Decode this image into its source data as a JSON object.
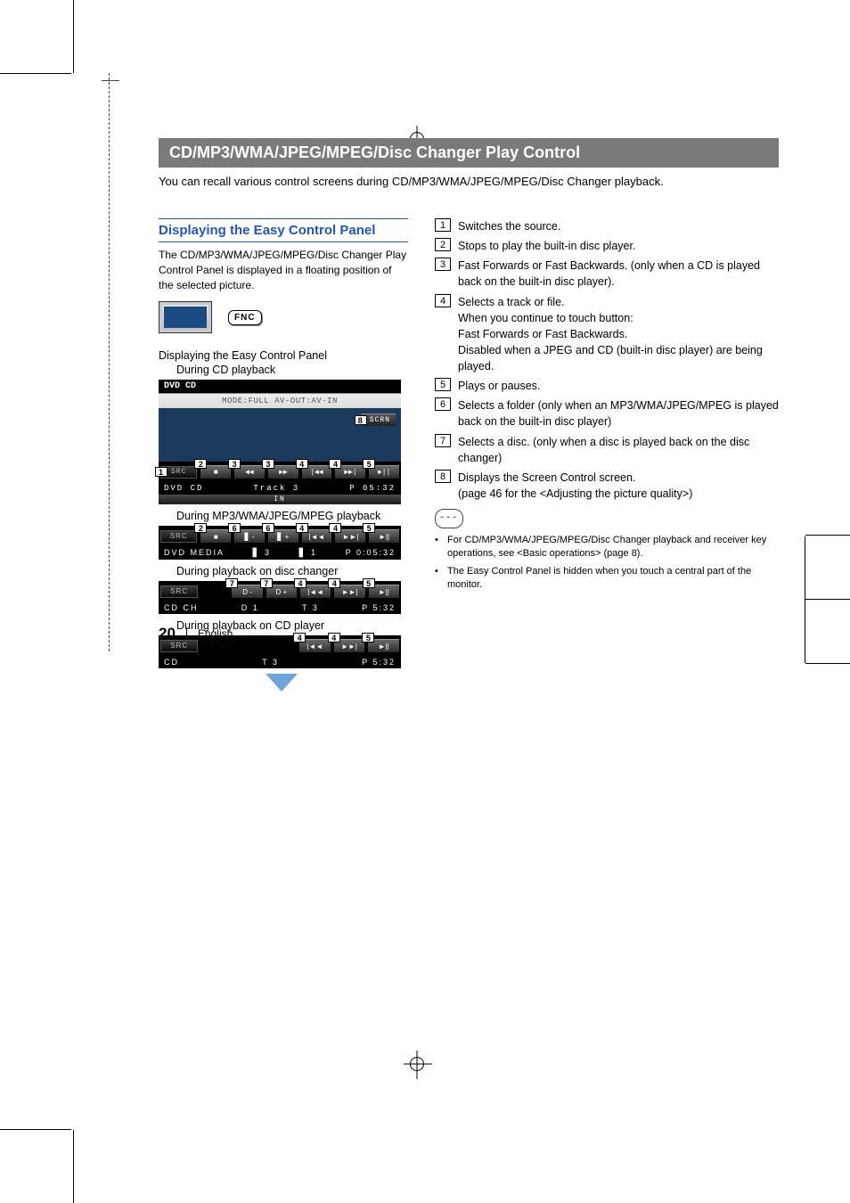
{
  "banner_title": "CD/MP3/WMA/JPEG/MPEG/Disc Changer Play Control",
  "intro": "You can recall various control screens during CD/MP3/WMA/JPEG/MPEG/Disc Changer playback.",
  "subhead": "Displaying the Easy Control Panel",
  "lead": "The CD/MP3/WMA/JPEG/MPEG/Disc Changer Play Control Panel is displayed in a floating position of the selected picture.",
  "fnc_label": "FNC",
  "step_title": "Displaying the Easy Control Panel",
  "sub_cd": "During CD playback",
  "sub_mp3": "During MP3/WMA/JPEG/MPEG playback",
  "sub_dc": "During playback on disc changer",
  "sub_cdp": "During playback on CD player",
  "panel_cd": {
    "title": "DVD CD",
    "header": "MODE:FULL  AV-OUT:AV-IN",
    "scrn": "SCRN",
    "src": "SRC",
    "btns": [
      "■",
      "◄◄",
      "►►",
      "|◄◄",
      "►►|",
      "►||"
    ],
    "info_left": "DVD CD",
    "info_mid": "Track 3",
    "info_right": "P 05:32",
    "in": "IN",
    "tags": [
      "1",
      "2",
      "3",
      "3",
      "4",
      "4",
      "5",
      "8"
    ]
  },
  "panel_mp3": {
    "src": "SRC",
    "btns": [
      "■",
      "▋ -",
      "▋ +",
      "|◄◄",
      "►►|",
      "►||"
    ],
    "info_left": "DVD MEDIA",
    "info_mid_a": "▋  3",
    "info_mid_b": "▋  1",
    "info_right": "P 0:05:32",
    "tags": [
      "2",
      "6",
      "6",
      "4",
      "4",
      "5"
    ]
  },
  "panel_dc": {
    "src": "SRC",
    "btns": [
      "D -",
      "D +",
      "|◄◄",
      "►►|",
      "►||"
    ],
    "info_left": "CD CH",
    "info_a": "D 1",
    "info_b": "T 3",
    "info_right": "P 5:32",
    "tags": [
      "7",
      "7",
      "4",
      "4",
      "5"
    ]
  },
  "panel_cdp": {
    "src": "SRC",
    "btns": [
      "|◄◄",
      "►►|",
      "►||"
    ],
    "info_left": "CD",
    "info_mid": "T 3",
    "info_right": "P 5:32",
    "tags": [
      "4",
      "4",
      "5"
    ]
  },
  "list": [
    {
      "n": "1",
      "t": "Switches the source."
    },
    {
      "n": "2",
      "t": "Stops to play the built-in disc player."
    },
    {
      "n": "3",
      "t": "Fast Forwards or Fast Backwards. (only when a CD is played back on the built-in disc player)."
    },
    {
      "n": "4",
      "t": "Selects a track or file.\nWhen you continue to touch button:\nFast Forwards or Fast Backwards.\nDisabled when a JPEG and CD (built-in disc player) are being played."
    },
    {
      "n": "5",
      "t": "Plays or pauses."
    },
    {
      "n": "6",
      "t": "Selects a folder (only when an MP3/WMA/JPEG/MPEG is played back on the built-in disc player)"
    },
    {
      "n": "7",
      "t": "Selects a disc. (only when a disc is played back on the disc changer)"
    },
    {
      "n": "8",
      "t": "Displays the Screen Control screen.\n(page 46 for the <Adjusting the picture quality>)"
    }
  ],
  "notes": [
    "For CD/MP3/WMA/JPEG/MPEG/Disc Changer playback and receiver key operations, see <Basic operations> (page 8).",
    "The Easy Control Panel is hidden when you touch a central part of the monitor."
  ],
  "footer": {
    "page": "20",
    "lang": "English"
  }
}
